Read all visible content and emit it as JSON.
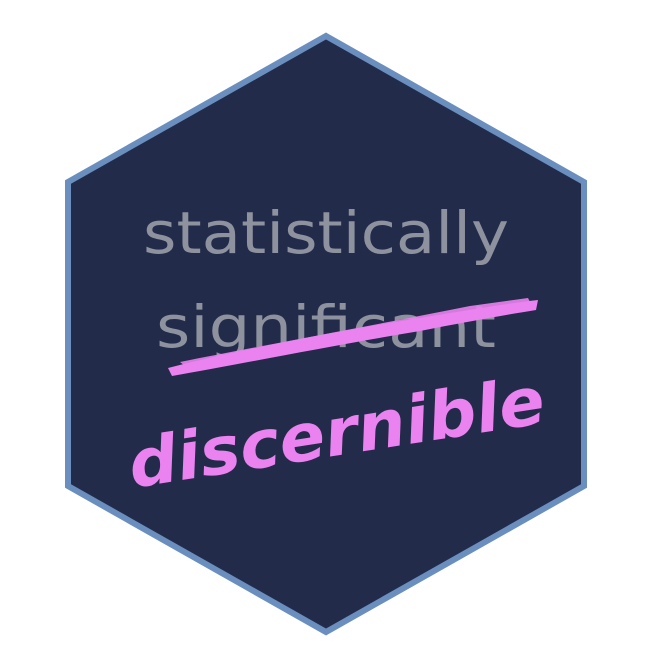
{
  "sticker": {
    "line1": "statistically",
    "line2": "significant",
    "replacement": "discernible"
  },
  "colors": {
    "background": "#222c4a",
    "border": "#6a8fbf",
    "text_gray": "#8e929e",
    "accent_pink": "#ea82ef"
  }
}
